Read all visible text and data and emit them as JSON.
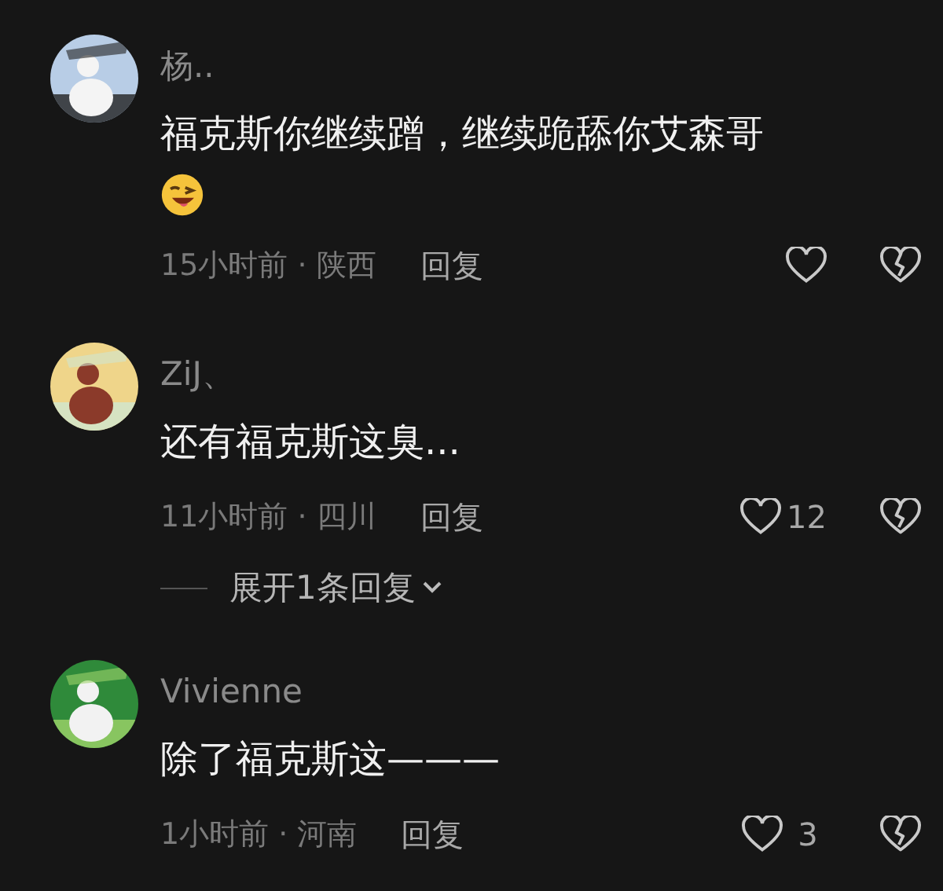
{
  "comments": [
    {
      "name": "杨..",
      "text": "福克斯你继续蹭，继续跪舔你艾森哥",
      "emoji": true,
      "meta": "15小时前 · 陕西",
      "reply": "回复"
    },
    {
      "name": "ZiJ、",
      "text": "还有福克斯这臭...",
      "emoji": false,
      "meta": "11小时前 · 四川",
      "reply": "回复",
      "likes": "12",
      "expand": "展开1条回复"
    },
    {
      "name": "Vivienne",
      "text": "除了福克斯这———",
      "emoji": false,
      "meta": "1小时前 · 河南",
      "reply": "回复",
      "likes": "3"
    }
  ]
}
